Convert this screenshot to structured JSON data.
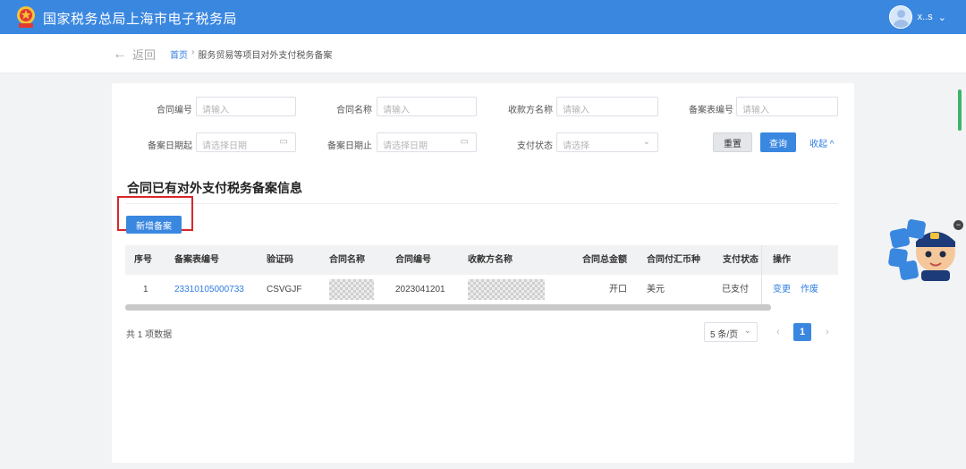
{
  "header": {
    "title": "国家税务总局上海市电子税务局",
    "user_name": "x..s",
    "user_menu_arrow": "⌄"
  },
  "nav": {
    "back_label": "返回",
    "breadcrumb_home": "首页",
    "breadcrumb_sep": "›",
    "breadcrumb_current": "服务贸易等项目对外支付税务备案"
  },
  "filters": {
    "contract_no": {
      "label": "合同编号",
      "placeholder": "请输入"
    },
    "contract_name": {
      "label": "合同名称",
      "placeholder": "请输入"
    },
    "payee_name": {
      "label": "收款方名称",
      "placeholder": "请输入"
    },
    "record_no": {
      "label": "备案表编号",
      "placeholder": "请输入"
    },
    "date_from": {
      "label": "备案日期起",
      "placeholder": "请选择日期"
    },
    "date_to": {
      "label": "备案日期止",
      "placeholder": "请选择日期"
    },
    "pay_status": {
      "label": "支付状态",
      "placeholder": "请选择"
    },
    "reset_label": "重置",
    "query_label": "查询",
    "collapse_label": "收起 ^"
  },
  "section": {
    "title": "合同已有对外支付税务备案信息",
    "add_label": "新增备案"
  },
  "table": {
    "headers": {
      "index": "序号",
      "record_no": "备案表编号",
      "verify_code": "验证码",
      "contract_name": "合同名称",
      "contract_no": "合同编号",
      "payee": "收款方名称",
      "total_amount": "合同总金额",
      "currency": "合同付汇币种",
      "pay_status": "支付状态",
      "ops": "操作"
    },
    "rows": [
      {
        "index": "1",
        "record_no": "23310105000733",
        "verify_code": "CSVGJF",
        "contract_name": "",
        "contract_no": "2023041201",
        "payee": "",
        "total_amount": "开口",
        "currency": "美元",
        "pay_status": "已支付",
        "op_change": "变更",
        "op_void": "作废"
      }
    ]
  },
  "pagination": {
    "total": "共 1 项数据",
    "page_size": "5 条/页",
    "page_size_arrow": "⌄",
    "prev": "‹",
    "current": "1",
    "next": "›"
  },
  "side_widget": {
    "close": "−"
  },
  "colors": {
    "primary": "#3a87e0",
    "link": "#2f7de1",
    "highlight_frame": "#d9262b"
  }
}
